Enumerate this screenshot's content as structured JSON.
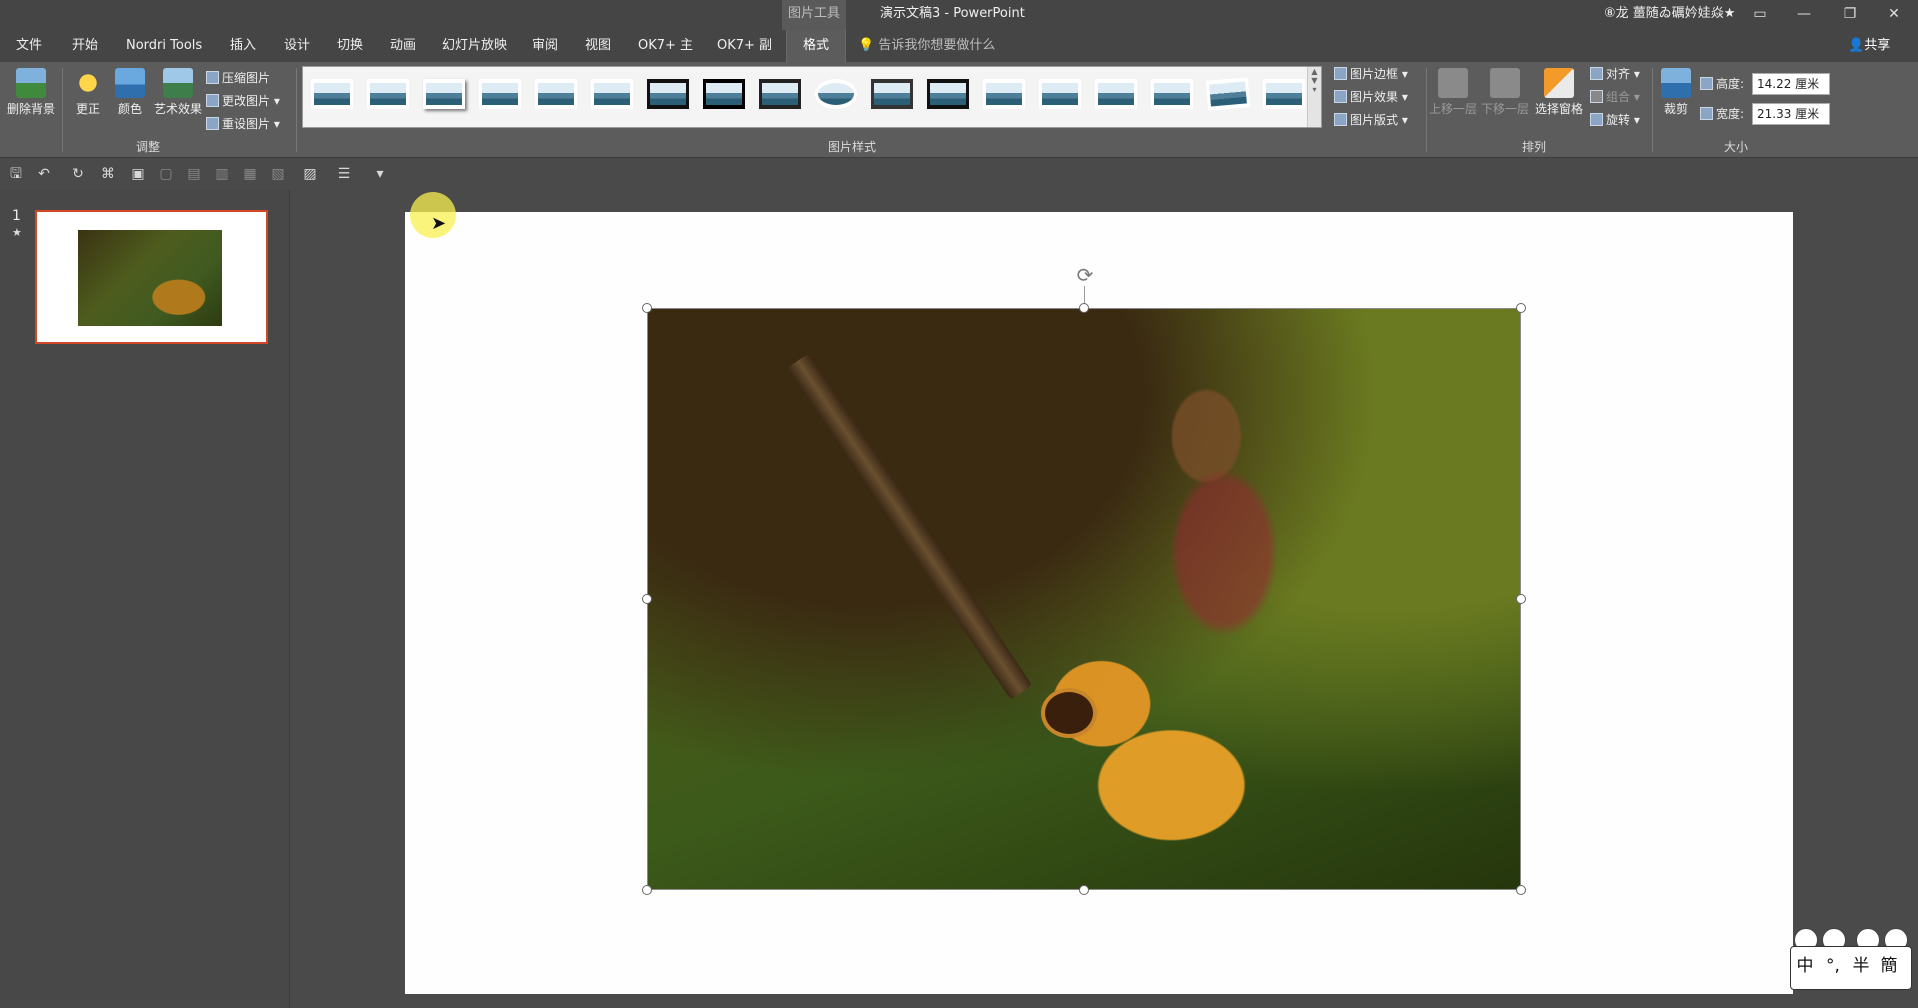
{
  "titlebar": {
    "context_tab": "图片工具",
    "document_title": "演示文稿3  -  PowerPoint",
    "user": "⑧龙 薑随ゐ礪妗娃焱★",
    "buttons": [
      "▭",
      "—",
      "❐",
      "✕"
    ]
  },
  "tabs": [
    "文件",
    "开始",
    "Nordri Tools",
    "插入",
    "设计",
    "切换",
    "动画",
    "幻灯片放映",
    "审阅",
    "视图",
    "OK7+ 主",
    "OK7+ 副",
    "格式"
  ],
  "active_tab": "格式",
  "tell_me": "告诉我你想要做什么",
  "share": "共享",
  "ribbon": {
    "adjust": {
      "remove_bg": "删除背景",
      "corrections": "更正",
      "color": "颜色",
      "artistic": "艺术效果",
      "compress": "压缩图片",
      "change_pic": "更改图片",
      "reset_pic": "重设图片",
      "label": "调整"
    },
    "styles": {
      "label": "图片样式",
      "border": "图片边框",
      "effects": "图片效果",
      "layout": "图片版式"
    },
    "arrange": {
      "label": "排列",
      "bring_forward": "上移一层",
      "send_backward": "下移一层",
      "selection_pane": "选择窗格",
      "align": "对齐",
      "group": "组合",
      "rotate": "旋转"
    },
    "size": {
      "label": "大小",
      "crop": "裁剪",
      "height_label": "高度:",
      "height_value": "14.22 厘米",
      "width_label": "宽度:",
      "width_value": "21.33 厘米"
    }
  },
  "slides": {
    "number": "1",
    "star": "★"
  },
  "ime": [
    "中",
    "°,",
    "半",
    "簡"
  ]
}
